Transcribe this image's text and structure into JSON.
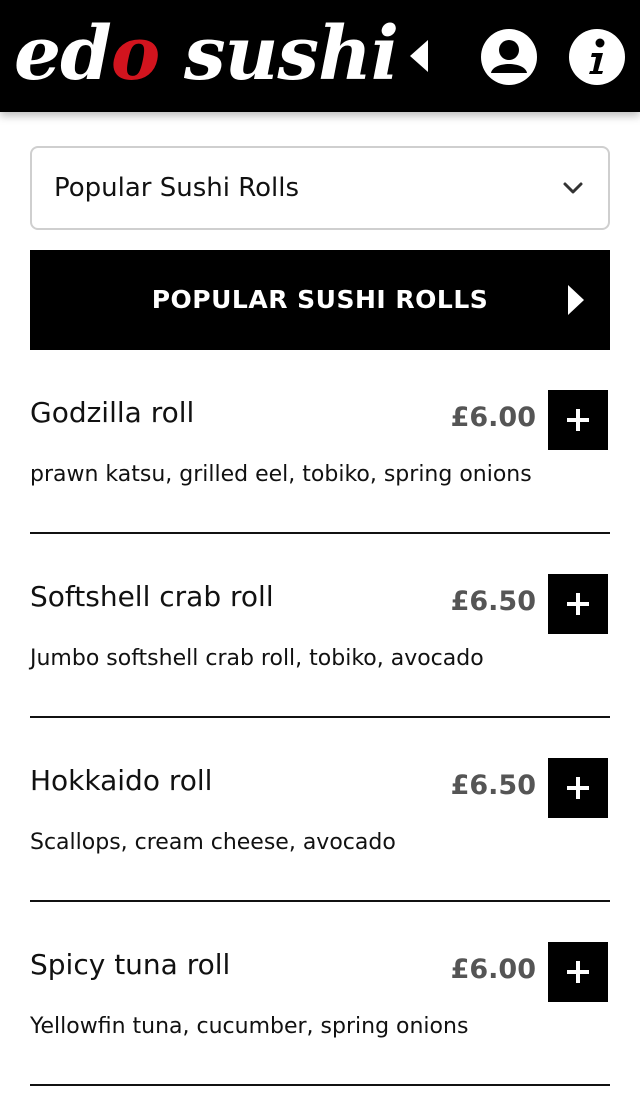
{
  "header": {
    "logo_text_part1": "ed",
    "logo_text_accent": "o",
    "logo_text_part2": " sushi",
    "accent_color": "#d2141e",
    "icons": [
      "back-icon",
      "account-icon",
      "info-icon"
    ]
  },
  "category_select": {
    "selected": "Popular Sushi Rolls",
    "icon": "chevron-down-icon"
  },
  "section": {
    "title": "POPULAR SUSHI ROLLS",
    "icon": "play-arrow-icon"
  },
  "items": [
    {
      "name": "Godzilla roll",
      "price": "£6.00",
      "description": "prawn katsu, grilled eel, tobiko, spring onions"
    },
    {
      "name": "Softshell crab roll",
      "price": "£6.50",
      "description": "Jumbo softshell crab roll, tobiko, avocado"
    },
    {
      "name": "Hokkaido roll",
      "price": "£6.50",
      "description": "Scallops, cream cheese, avocado"
    },
    {
      "name": "Spicy tuna roll",
      "price": "£6.00",
      "description": "Yellowfin tuna, cucumber, spring onions"
    }
  ]
}
